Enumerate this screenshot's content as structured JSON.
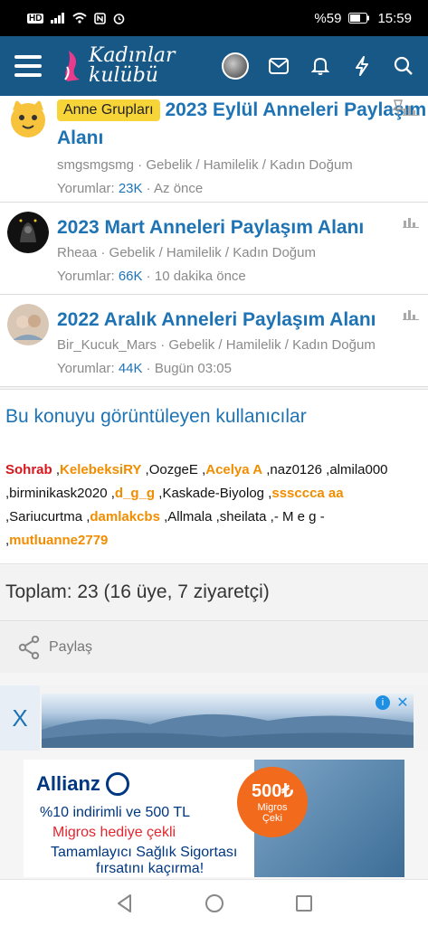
{
  "status": {
    "battery": "%59",
    "time": "15:59",
    "hd": "HD"
  },
  "appbar": {
    "logo_line1": "Kadınlar",
    "logo_line2": "kulübü"
  },
  "threads": [
    {
      "badge": "Anne Grupları",
      "title": "2023 Eylül Anneleri Paylaşım Alanı",
      "author": "smgsmgsmg",
      "forum": "Gebelik / Hamilelik / Kadın Doğum",
      "replies_label": "Yorumlar:",
      "replies": "23K",
      "time": "Az önce"
    },
    {
      "title": "2023 Mart Anneleri Paylaşım Alanı",
      "author": "Rheaa",
      "forum": "Gebelik / Hamilelik / Kadın Doğum",
      "replies_label": "Yorumlar:",
      "replies": "66K",
      "time": "10 dakika önce"
    },
    {
      "title": "2022 Aralık Anneleri Paylaşım Alanı",
      "author": "Bir_Kucuk_Mars",
      "forum": "Gebelik / Hamilelik / Kadın Doğum",
      "replies_label": "Yorumlar:",
      "replies": "44K",
      "time": "Bugün 03:05"
    }
  ],
  "viewers": {
    "heading": "Bu konuyu görüntüleyen kullanıcılar",
    "users": [
      {
        "name": "Sohrab",
        "style": "red"
      },
      {
        "name": "KelebeksiRY",
        "style": "orange"
      },
      {
        "name": "OozgeE",
        "style": "plain"
      },
      {
        "name": "Acelya A",
        "style": "orange"
      },
      {
        "name": "naz0126",
        "style": "plain"
      },
      {
        "name": "almila000",
        "style": "plain"
      },
      {
        "name": "birminikask2020",
        "style": "plain"
      },
      {
        "name": "d_g_g",
        "style": "orange"
      },
      {
        "name": "Kaskade-Biyolog",
        "style": "plain"
      },
      {
        "name": "sssccca aa",
        "style": "orange"
      },
      {
        "name": "Sariucurtma",
        "style": "plain"
      },
      {
        "name": "damlakcbs",
        "style": "orange"
      },
      {
        "name": "Allmala",
        "style": "plain"
      },
      {
        "name": "sheilata",
        "style": "plain"
      },
      {
        "name": "- M e g -",
        "style": "plain"
      },
      {
        "name": "mutluanne2779",
        "style": "orange"
      }
    ]
  },
  "total": "Toplam: 23 (16 üye, 7 ziyaretçi)",
  "share_label": "Paylaş",
  "ad": {
    "close": "X",
    "brand": "Allianz",
    "line1": "%10 indirimli ve 500 TL",
    "line2": "Migros hediye çekli",
    "line3": "Tamamlayıcı Sağlık Sigortası",
    "line4": "fırsatını kaçırma!",
    "circle_amount": "500₺",
    "circle_text1": "Migros",
    "circle_text2": "Çeki"
  },
  "colors": {
    "appbar": "#185886",
    "link": "#1e73b4",
    "badge": "#f7d539",
    "red_user": "#d8161c",
    "orange_user": "#f08d00"
  }
}
